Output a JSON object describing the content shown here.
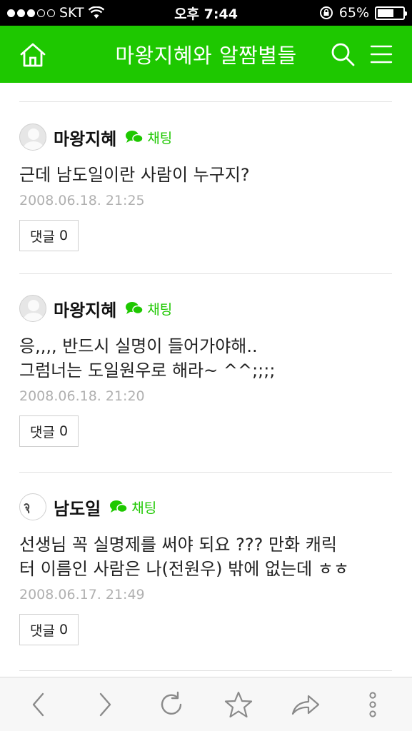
{
  "status_bar": {
    "carrier": "SKT",
    "time": "오후 7:44",
    "battery": "65%",
    "battery_level": 0.65
  },
  "header": {
    "title": "마왕지혜와 알짬별들"
  },
  "chat_label": "채팅",
  "comment_label": "댓글",
  "posts": [
    {
      "author": "마왕지혜",
      "lines": [
        "근데 남도일이란 사람이 누구지?"
      ],
      "date": "2008.06.18. 21:25",
      "comment_count": "0"
    },
    {
      "author": "마왕지혜",
      "lines": [
        "응,,,, 반드시 실명이 들어가야해..",
        "그럼너는 도일원우로 해라~ ^^;;;;"
      ],
      "date": "2008.06.18. 21:20",
      "comment_count": "0"
    },
    {
      "author": "남도일",
      "lines": [
        "선생님 꼭 실명제를 써야 되요 ??? 만화 캐릭",
        "터 이름인 사람은 나(전원우) 밖에 없는데 ㅎㅎ"
      ],
      "date": "2008.06.17. 21:49",
      "comment_count": "0"
    }
  ],
  "colors": {
    "brand": "#1ec800",
    "date": "#b0b0b0"
  }
}
